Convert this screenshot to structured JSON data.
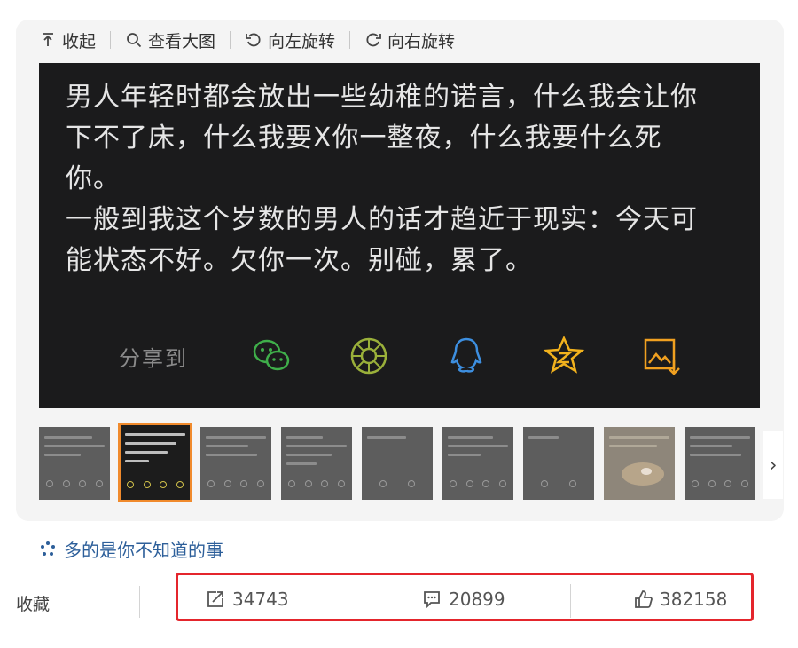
{
  "toolbar": {
    "collapse": "收起",
    "view_large": "查看大图",
    "rotate_left": "向左旋转",
    "rotate_right": "向右旋转"
  },
  "post": {
    "lines": [
      "男人年轻时都会放出一些幼稚的诺言，什么我会让你",
      "下不了床，什么我要X你一整夜，什么我要什么死",
      "你。",
      "一般到我这个岁数的男人的话才趋近于现实：今天可",
      "能状态不好。欠你一次。别碰，累了。"
    ]
  },
  "share": {
    "label": "分享到",
    "icons": [
      "wechat-icon",
      "moments-icon",
      "qq-icon",
      "qzone-icon",
      "save-image-icon"
    ],
    "colors": {
      "wechat": "#3fae4a",
      "moments": "#9ab03a",
      "qq": "#3d8fe0",
      "qzone": "#f2b21d",
      "save": "#f0a020"
    }
  },
  "thumbnails": {
    "count": 9,
    "active_index": 1,
    "next_glyph": "›"
  },
  "topic": {
    "label": "多的是你不知道的事"
  },
  "actions": {
    "favorite": "收藏",
    "repost_count": "34743",
    "comment_count": "20899",
    "like_count": "382158"
  },
  "colors": {
    "highlight_box": "#e4252c",
    "link": "#2d5f9a",
    "active_thumb": "#f08a2c"
  }
}
